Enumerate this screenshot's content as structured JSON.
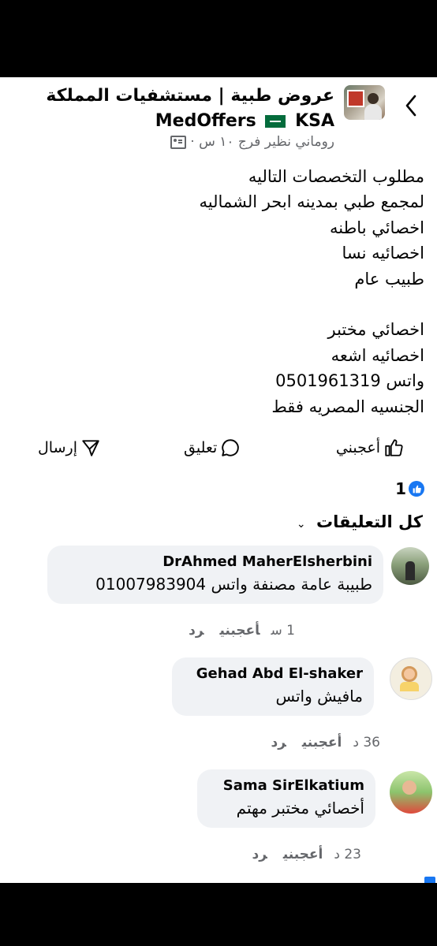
{
  "header": {
    "back_icon": "chevron-left-icon",
    "group_name_line1": "عروض طبية | مستشفيات المملكة",
    "group_name_line2_prefix": "MedOffers",
    "group_name_line2_suffix": "KSA",
    "author": "روماني نظير فرج",
    "time": "١٠ س",
    "separator": "·",
    "audience_icon": "group-icon"
  },
  "post": {
    "lines": [
      "مطلوب التخصصات التاليه",
      "لمجمع طبي  بمدينه ابحر الشماليه",
      "اخصائي باطنه",
      "اخصائيه نسا",
      "طبيب عام",
      "",
      "اخصائي مختبر",
      "اخصائيه اشعه",
      "واتس 0501961319",
      "الجنسيه المصريه فقط"
    ]
  },
  "actions": {
    "like": "أعجبني",
    "comment": "تعليق",
    "send": "إرسال"
  },
  "reactions": {
    "count": "1"
  },
  "comments_header": {
    "label": "كل التعليقات",
    "chevron": "⌄"
  },
  "comments": [
    {
      "name": "DrAhmed MaherElsherbini",
      "text": "طبيبة عامة مصنفة واتس 01007983904",
      "time": "1 س",
      "like": "أعجبني",
      "reply": "رد"
    },
    {
      "name": "Gehad Abd El-shaker",
      "text": "مافيش واتس",
      "time": "36 د",
      "like": "أعجبني",
      "reply": "رد"
    },
    {
      "name": "Sama SirElkatium",
      "text": "أخصائي مختبر مهتم",
      "time": "23 د",
      "like": "أعجبني",
      "reply": "رد"
    }
  ],
  "colors": {
    "accent": "#1877f2",
    "secondary_text": "#65676b",
    "bubble": "#f0f2f5"
  }
}
